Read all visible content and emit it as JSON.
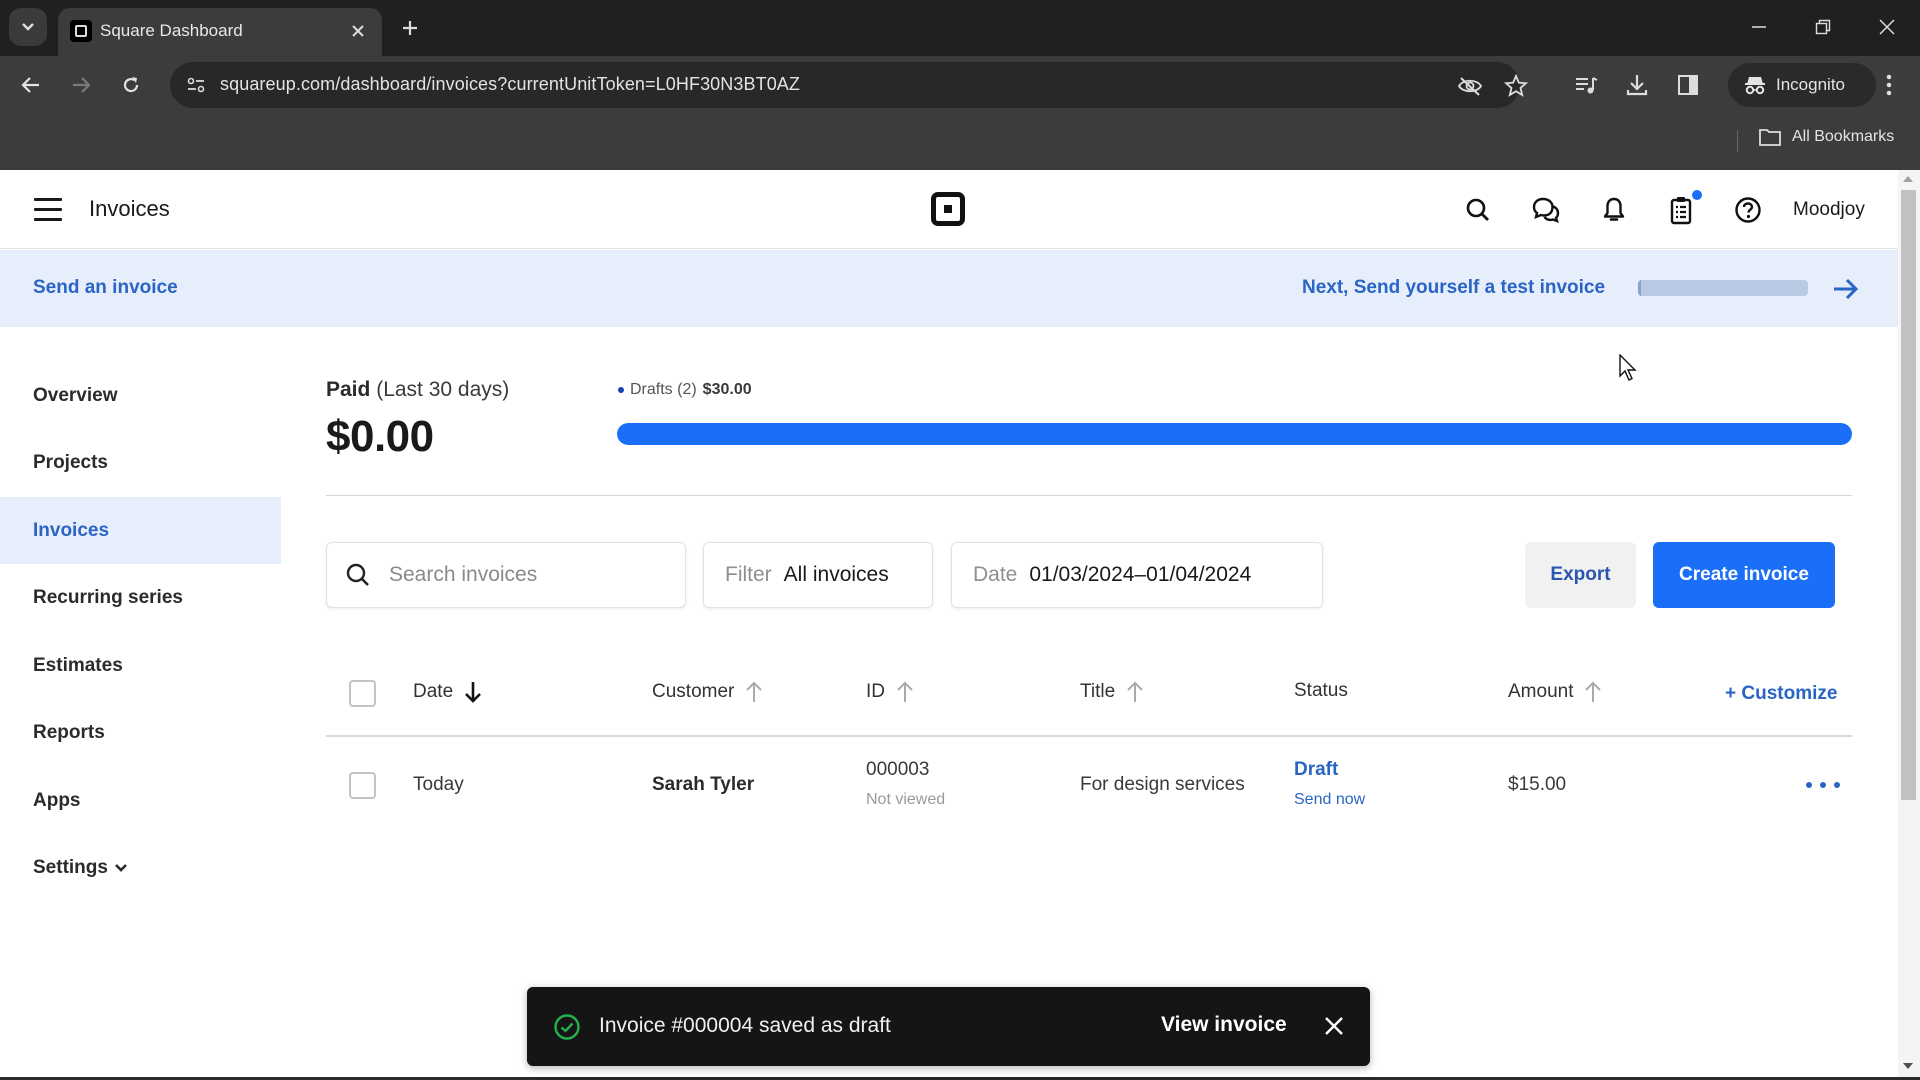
{
  "browser": {
    "tab_title": "Square Dashboard",
    "url": "squareup.com/dashboard/invoices?currentUnitToken=L0HF30N3BT0AZ",
    "incognito_label": "Incognito",
    "bookmarks_label": "All Bookmarks"
  },
  "header": {
    "title": "Invoices",
    "user_name": "Moodjoy",
    "icons": [
      "menu-icon",
      "square-logo",
      "search-icon",
      "messages-icon",
      "bell-icon",
      "clipboard-icon",
      "help-icon"
    ],
    "notification_dot_color": "#1a6ef7"
  },
  "banner": {
    "left_link": "Send an invoice",
    "next_label": "Next, Send yourself a test invoice",
    "progress_fraction": 0.02
  },
  "sidebar": {
    "items": [
      {
        "label": "Overview",
        "active": false
      },
      {
        "label": "Projects",
        "active": false
      },
      {
        "label": "Invoices",
        "active": true
      },
      {
        "label": "Recurring series",
        "active": false
      },
      {
        "label": "Estimates",
        "active": false
      },
      {
        "label": "Reports",
        "active": false
      },
      {
        "label": "Apps",
        "active": false
      },
      {
        "label": "Settings",
        "active": false,
        "has_chevron": true
      }
    ]
  },
  "summary": {
    "paid_label": "Paid",
    "paid_period": "(Last 30 days)",
    "paid_amount": "$0.00",
    "drafts_label": "Drafts (2)",
    "drafts_amount": "$30.00",
    "drafts_fraction": 1.0,
    "bar_color": "#1a6ef7"
  },
  "toolbar": {
    "search_placeholder": "Search invoices",
    "search_value": "",
    "filter_label": "Filter",
    "filter_value": "All invoices",
    "date_label": "Date",
    "date_value": "01/03/2024–01/04/2024",
    "export_label": "Export",
    "create_label": "Create invoice",
    "accent_color": "#1a6ef7"
  },
  "table": {
    "columns": [
      {
        "label": "Date",
        "sort": "down"
      },
      {
        "label": "Customer",
        "sort": "up"
      },
      {
        "label": "ID",
        "sort": "up"
      },
      {
        "label": "Title",
        "sort": "up"
      },
      {
        "label": "Status",
        "sort": null
      },
      {
        "label": "Amount",
        "sort": "up"
      }
    ],
    "customize_label": "+ Customize",
    "rows": [
      {
        "date": "Today",
        "customer": "Sarah Tyler",
        "id": "000003",
        "id_sub": "Not viewed",
        "title": "For design services",
        "status": "Draft",
        "status_action": "Send now",
        "amount": "$15.00"
      }
    ]
  },
  "toast": {
    "message": "Invoice #000004 saved as draft",
    "action": "View invoice",
    "success_color": "#22b14c"
  }
}
